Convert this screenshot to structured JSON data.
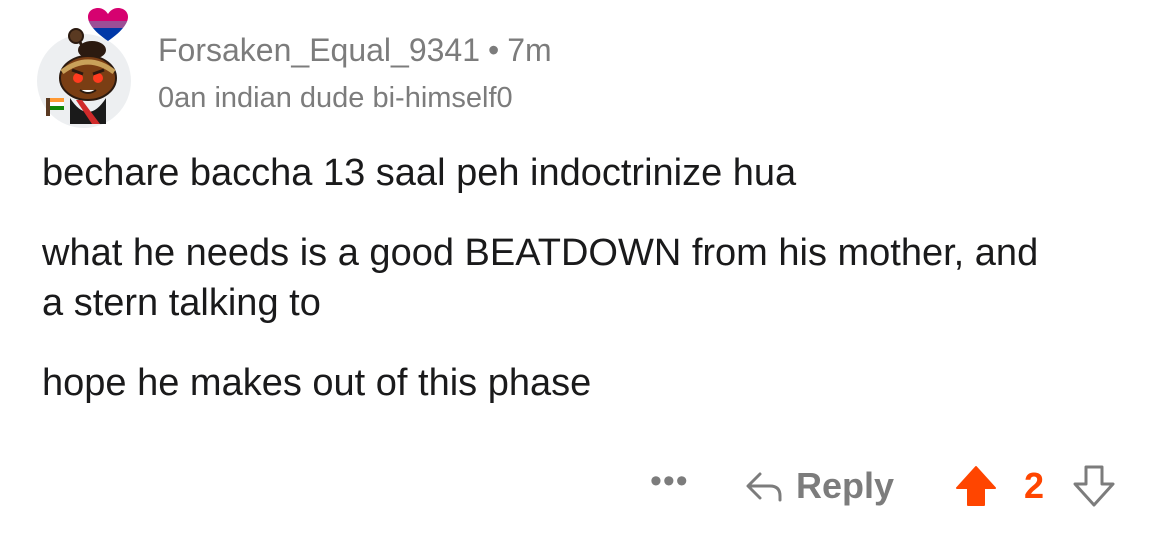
{
  "comment": {
    "author": "Forsaken_Equal_9341",
    "separator": "•",
    "age": "7m",
    "flair": "0an indian dude bi-himself0",
    "paragraphs": [
      "bechare baccha 13 saal peh indoctrinize hua",
      "what he needs is a good BEATDOWN from his mother, and a stern talking to",
      "hope he makes out of this phase"
    ]
  },
  "actions": {
    "more_label": "•••",
    "reply_label": "Reply",
    "score": "2",
    "upvoted": true
  },
  "icons": {
    "avatar": "snoo-avatar-icon",
    "flair_badge": "bi-pride-heart-icon",
    "reply": "reply-arrow-icon",
    "upvote": "upvote-arrow-icon",
    "downvote": "downvote-arrow-icon"
  },
  "colors": {
    "upvote_active": "#ff4500",
    "muted_text": "#7c7c7c",
    "body_text": "#1a1a1b",
    "avatar_background": "#edeff1"
  }
}
